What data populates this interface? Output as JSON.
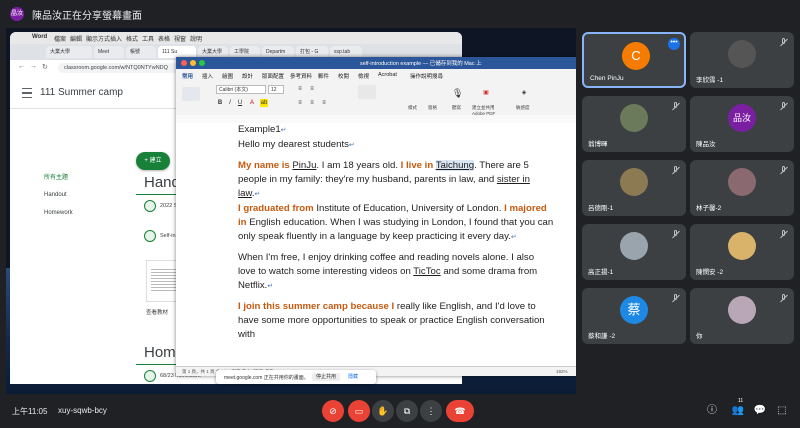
{
  "banner": {
    "avatar_initial": "晶汝",
    "title": "陳品汝正在分享螢幕畫面"
  },
  "browser": {
    "menu": [
      "Word",
      "檔案",
      "編輯",
      "顯示方式",
      "插入",
      "格式",
      "工具",
      "表格",
      "視窗",
      "說明"
    ],
    "tabs": [
      "大業大學",
      "Meet",
      "帳號",
      "111 Su",
      "大業大學",
      "工學院",
      "Departm",
      "打包 - G",
      "ssp.tab"
    ],
    "url": "classroom.google.com/w/NTQ0NTYwNDQ"
  },
  "classroom": {
    "title": "111 Summer camp",
    "nav": [
      "所有主題",
      "Handout",
      "Homework"
    ],
    "create_label": "+ 建立",
    "section1": "Hando",
    "section2": "Homew",
    "assignments": [
      "2022 S",
      "Self-in",
      "68/23 homework"
    ],
    "view_material": "查看教材"
  },
  "word": {
    "filename": "self-introduction example — 已儲存到我的 Mac 上",
    "ribbon_tabs": [
      "常用",
      "插入",
      "繪圖",
      "設計",
      "版面配置",
      "參考資料",
      "郵件",
      "校閱",
      "檢視",
      "Acrobat",
      "操作說明搜尋"
    ],
    "font_name": "Calibri (本文)",
    "font_size": "12",
    "ribbon_labels": [
      "樣式",
      "窗格",
      "聽寫",
      "建立並共用 Adobe PDF",
      "敏感度"
    ],
    "doc": {
      "line1": "Example1",
      "line2": "Hello my dearest students",
      "p1_hl1": "My name is",
      "p1_name": "PinJu",
      "p1_mid": ". I am 18 years old.",
      "p1_hl2": "I live in",
      "p1_city": "Taichung",
      "p1_rest": ". There are 5 people in my family: they're my husband, parents in law, and",
      "p1_sister": "sister in law",
      "p1_end": ".",
      "p2_hl1": "I graduated from",
      "p2_mid": " Institute of Education, University of London.",
      "p2_hl2": "I majored in",
      "p2_rest": " English education. When I was studying in London, I found that you can only speak fluently in a language by keep practicing it every day.",
      "p3_a": "When I'm free, I enjoy drinking coffee and reading novels alone. I also love to watch some interesting videos on",
      "p3_tictoc": "TicToc",
      "p3_b": " and some drama from Netflix.",
      "p4_hl": "I join this summer camp because I",
      "p4_rest": " really like English, and I'd love to have some more opportunities to speak or practice English conversation with"
    },
    "status": "第 1 頁，共 1 頁   共 2/16 個字   英文 (美國)   焦點",
    "zoom": "192%"
  },
  "share_notice": {
    "text": "meet.google.com 正在共用你的畫面。",
    "stop": "停止共用",
    "hide": "隱藏"
  },
  "participants": [
    {
      "name": "Chen PinJu",
      "type": "initial",
      "initial": "C",
      "color": "#f57c00",
      "active": true,
      "muted": false,
      "more": "•••"
    },
    {
      "name": "李欣霈 -1",
      "type": "photo",
      "color": "#555555",
      "muted": true
    },
    {
      "name": "翁博暉",
      "type": "photo",
      "color": "#6b7a5a",
      "muted": true
    },
    {
      "name": "陳品汝",
      "type": "initial",
      "initial": "品汝",
      "color": "#7b1fa2",
      "muted": true
    },
    {
      "name": "呂德剛-1",
      "type": "photo",
      "color": "#8c7a52",
      "muted": true
    },
    {
      "name": "林子馨-2",
      "type": "photo",
      "color": "#8a6a70",
      "muted": true
    },
    {
      "name": "高正揚-1",
      "type": "photo",
      "color": "#9aa4ad",
      "muted": true
    },
    {
      "name": "陳憫安 -2",
      "type": "photo",
      "color": "#d9b36a",
      "muted": true
    },
    {
      "name": "蔡和謙 -2",
      "type": "initial",
      "initial": "蔡",
      "color": "#1e88e5",
      "muted": true
    },
    {
      "name": "你",
      "type": "photo",
      "color": "#b9a7b8",
      "muted": true
    }
  ],
  "bottom": {
    "time": "上午11:05",
    "code": "xuy-sqwb-bcy",
    "participant_count": "11",
    "controls": [
      "mic-off",
      "camera-off",
      "raise-hand",
      "present",
      "more",
      "end-call"
    ]
  }
}
